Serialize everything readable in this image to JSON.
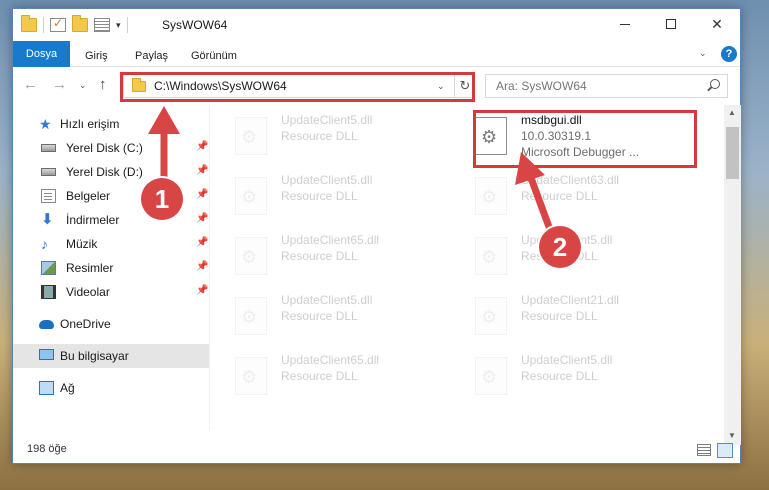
{
  "window": {
    "title": "SysWOW64"
  },
  "ribbon": {
    "tabs": [
      "Dosya",
      "Giriş",
      "Paylaş",
      "Görünüm"
    ],
    "help_label": "?"
  },
  "nav": {
    "address": "C:\\Windows\\SysWOW64",
    "search_placeholder": "Ara: SysWOW64"
  },
  "sidebar": {
    "quick_access": "Hızlı erişim",
    "items": [
      {
        "label": "Yerel Disk (C:)",
        "icon": "disk-icon"
      },
      {
        "label": "Yerel Disk (D:)",
        "icon": "disk-icon"
      },
      {
        "label": "Belgeler",
        "icon": "documents-icon"
      },
      {
        "label": "İndirmeler",
        "icon": "download-icon"
      },
      {
        "label": "Müzik",
        "icon": "music-icon"
      },
      {
        "label": "Resimler",
        "icon": "pictures-icon"
      },
      {
        "label": "Videolar",
        "icon": "videos-icon"
      }
    ],
    "onedrive": "OneDrive",
    "this_pc": "Bu bilgisayar",
    "network": "Ağ"
  },
  "files": {
    "highlighted": {
      "name": "msdbgui.dll",
      "version": "10.0.30319.1",
      "description": "Microsoft Debugger ..."
    },
    "left_column": [
      {
        "name": "UpdateClient5.dll",
        "type": "Resource DLL"
      },
      {
        "name": "UpdateClient5.dll",
        "type": "Resource DLL"
      },
      {
        "name": "UpdateClient65.dll",
        "type": "Resource DLL"
      },
      {
        "name": "UpdateClient5.dll",
        "type": "Resource DLL"
      },
      {
        "name": "UpdateClient65.dll",
        "type": "Resource DLL"
      }
    ],
    "right_column": [
      {
        "name": "UpdateClient63.dll",
        "type": "Resource DLL"
      },
      {
        "name": "UpdateClient5.dll",
        "type": "Resource DLL"
      },
      {
        "name": "UpdateClient21.dll",
        "type": "Resource DLL"
      },
      {
        "name": "UpdateClient5.dll",
        "type": "Resource DLL"
      }
    ]
  },
  "status": {
    "item_count": "198 öğe"
  },
  "annotations": {
    "step1": "1",
    "step2": "2",
    "color": "#d84545"
  }
}
